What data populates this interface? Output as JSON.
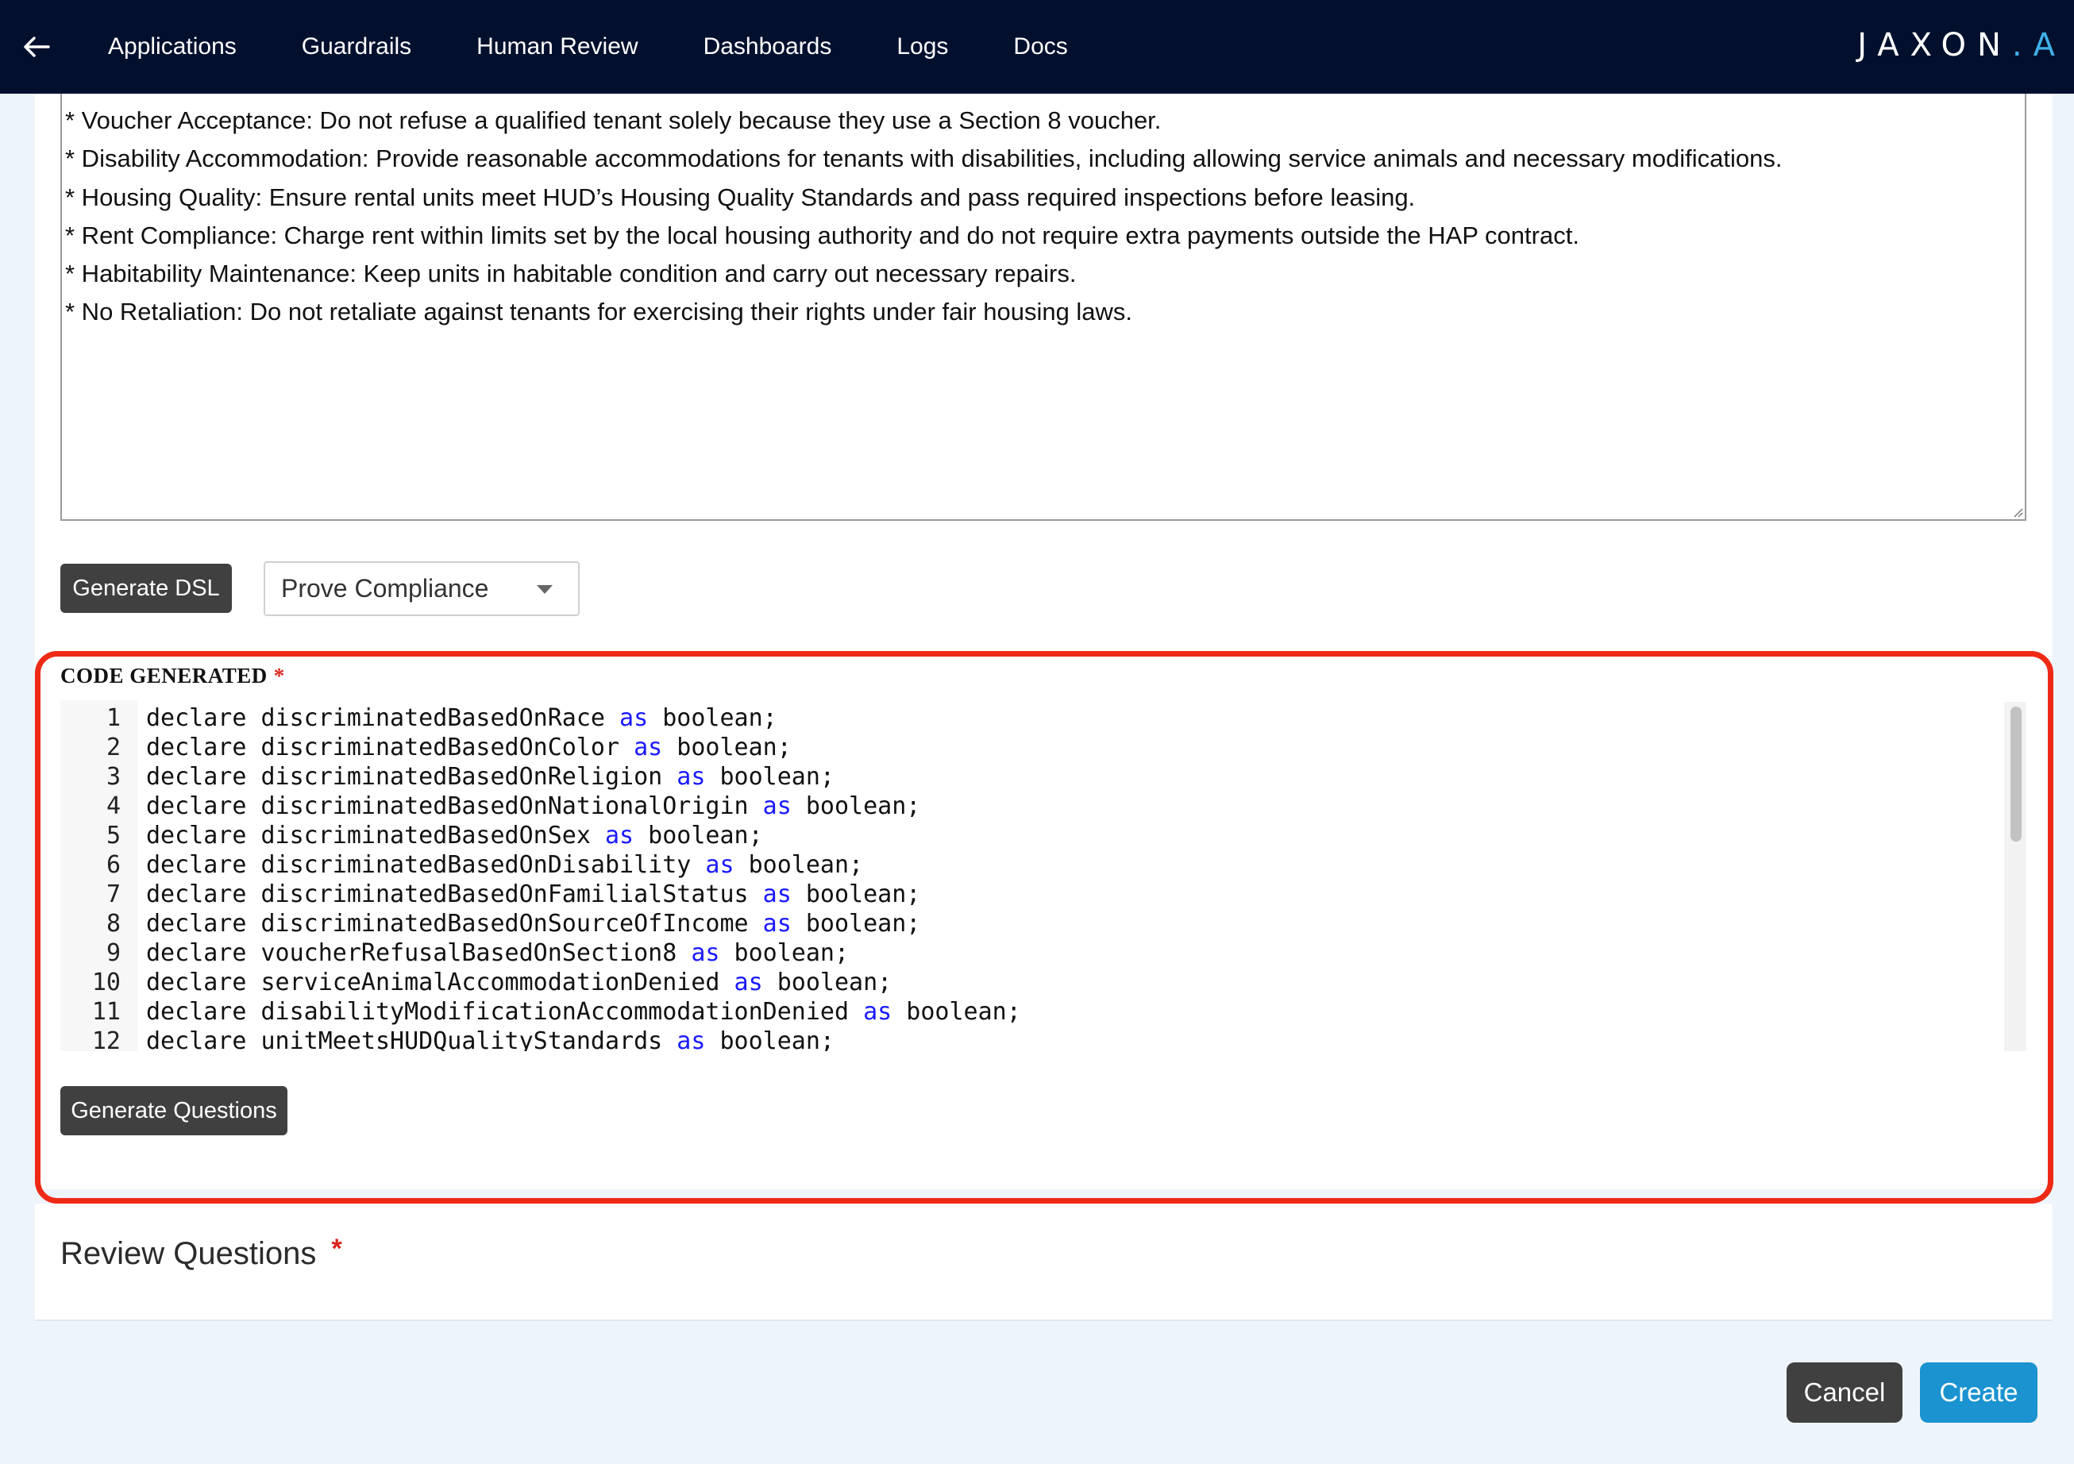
{
  "nav": {
    "back_icon": "arrow-left-icon",
    "items": [
      "Applications",
      "Guardrails",
      "Human Review",
      "Dashboards",
      "Logs",
      "Docs"
    ],
    "logo_main": "JAXON",
    "logo_accent": ".A"
  },
  "policy_text": {
    "lines": [
      "* Voucher Acceptance: Do not refuse a qualified tenant solely because they use a Section 8 voucher.",
      "* Disability Accommodation: Provide reasonable accommodations for tenants with disabilities, including allowing service animals and necessary modifications.",
      "* Housing Quality: Ensure rental units meet HUD’s Housing Quality Standards and pass required inspections before leasing.",
      "* Rent Compliance: Charge rent within limits set by the local housing authority and do not require extra payments outside the HAP contract.",
      "* Habitability Maintenance: Keep units in habitable condition and carry out necessary repairs.",
      "* No Retaliation: Do not retaliate against tenants for exercising their rights under fair housing laws."
    ]
  },
  "actions": {
    "generate_dsl": "Generate DSL",
    "mode_select": "Prove Compliance",
    "generate_questions": "Generate Questions"
  },
  "code_section": {
    "label": "CODE GENERATED",
    "required_mark": "*",
    "lines": [
      {
        "num": "1",
        "pre": "declare discriminatedBasedOnRace ",
        "kw": "as",
        "post": " boolean;"
      },
      {
        "num": "2",
        "pre": "declare discriminatedBasedOnColor ",
        "kw": "as",
        "post": " boolean;"
      },
      {
        "num": "3",
        "pre": "declare discriminatedBasedOnReligion ",
        "kw": "as",
        "post": " boolean;"
      },
      {
        "num": "4",
        "pre": "declare discriminatedBasedOnNationalOrigin ",
        "kw": "as",
        "post": " boolean;"
      },
      {
        "num": "5",
        "pre": "declare discriminatedBasedOnSex ",
        "kw": "as",
        "post": " boolean;"
      },
      {
        "num": "6",
        "pre": "declare discriminatedBasedOnDisability ",
        "kw": "as",
        "post": " boolean;"
      },
      {
        "num": "7",
        "pre": "declare discriminatedBasedOnFamilialStatus ",
        "kw": "as",
        "post": " boolean;"
      },
      {
        "num": "8",
        "pre": "declare discriminatedBasedOnSourceOfIncome ",
        "kw": "as",
        "post": " boolean;"
      },
      {
        "num": "9",
        "pre": "declare voucherRefusalBasedOnSection8 ",
        "kw": "as",
        "post": " boolean;"
      },
      {
        "num": "10",
        "pre": "declare serviceAnimalAccommodationDenied ",
        "kw": "as",
        "post": " boolean;"
      },
      {
        "num": "11",
        "pre": "declare disabilityModificationAccommodationDenied ",
        "kw": "as",
        "post": " boolean;"
      },
      {
        "num": "12",
        "pre": "declare unitMeetsHUDQualityStandards ",
        "kw": "as",
        "post": " boolean;"
      }
    ]
  },
  "review": {
    "title": "Review Questions",
    "required_mark": "*"
  },
  "footer": {
    "cancel": "Cancel",
    "create": "Create"
  },
  "colors": {
    "nav_bg": "#02102e",
    "highlight_border": "#ee2a16",
    "primary": "#1a93d0",
    "dark_button": "#404040",
    "keyword": "#1a1aff"
  }
}
